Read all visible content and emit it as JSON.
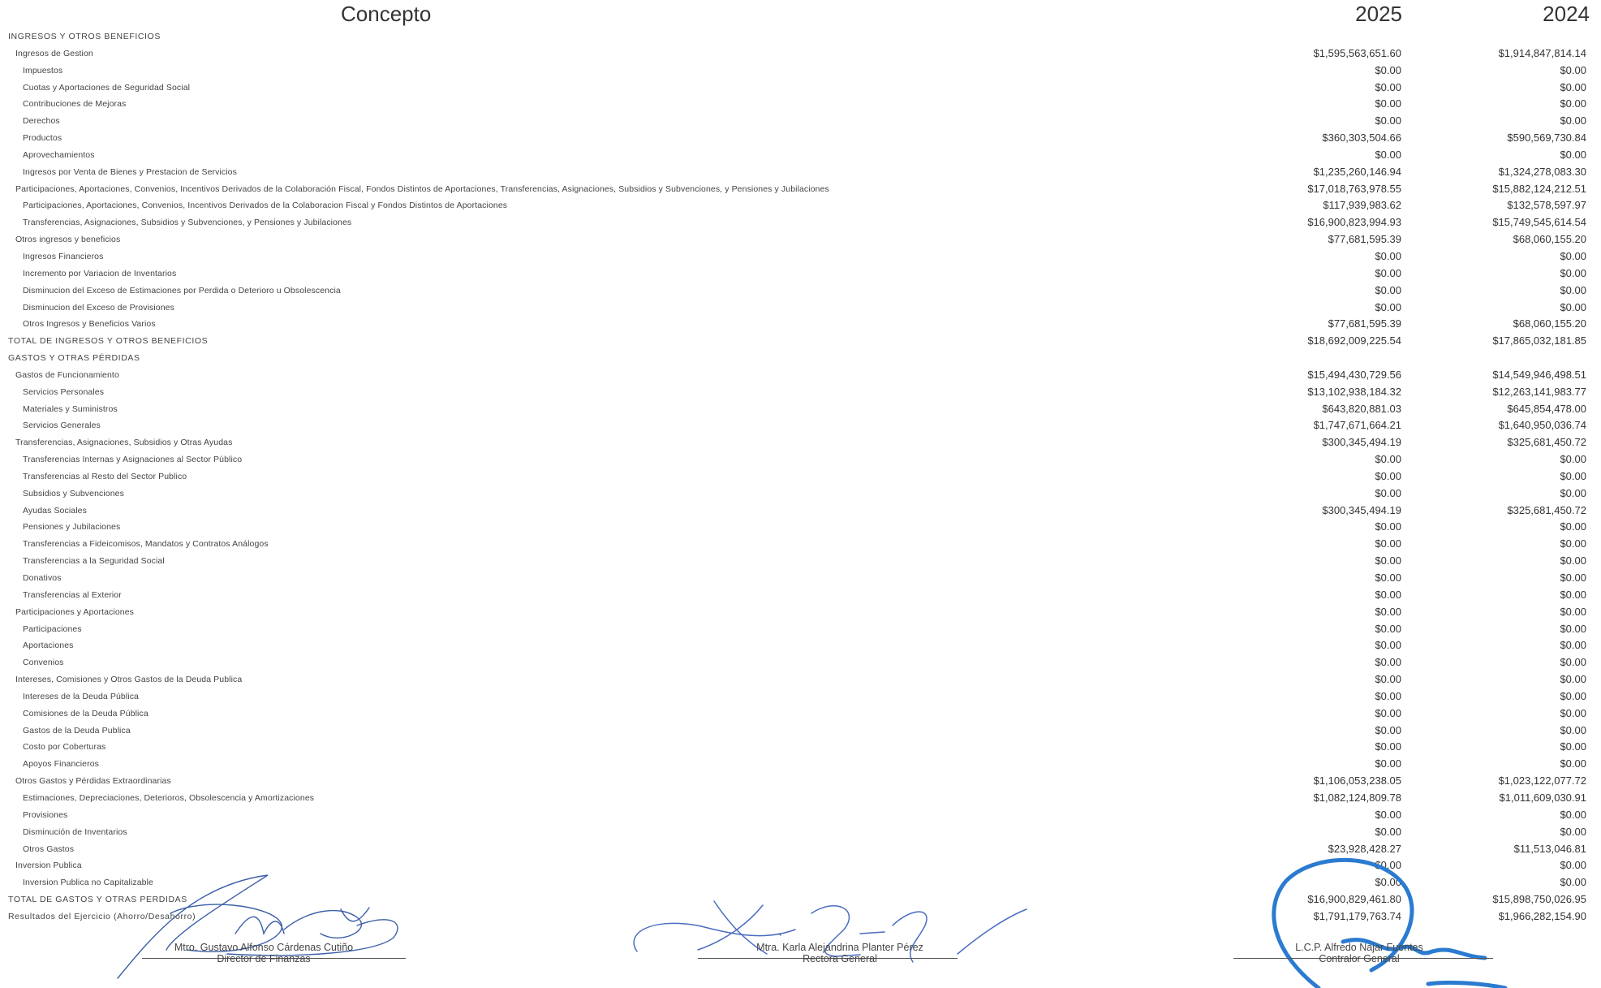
{
  "header": {
    "concept": "Concepto",
    "year_current": "2025",
    "year_previous": "2024"
  },
  "rows": [
    {
      "level": 0,
      "label": "INGRESOS Y OTROS BENEFICIOS",
      "v2025": "",
      "v2024": ""
    },
    {
      "level": 1,
      "label": "Ingresos de Gestion",
      "v2025": "$1,595,563,651.60",
      "v2024": "$1,914,847,814.14"
    },
    {
      "level": 2,
      "label": "Impuestos",
      "v2025": "$0.00",
      "v2024": "$0.00"
    },
    {
      "level": 2,
      "label": "Cuotas y Aportaciones de Seguridad Social",
      "v2025": "$0.00",
      "v2024": "$0.00"
    },
    {
      "level": 2,
      "label": "Contribuciones de Mejoras",
      "v2025": "$0.00",
      "v2024": "$0.00"
    },
    {
      "level": 2,
      "label": "Derechos",
      "v2025": "$0.00",
      "v2024": "$0.00"
    },
    {
      "level": 2,
      "label": "Productos",
      "v2025": "$360,303,504.66",
      "v2024": "$590,569,730.84"
    },
    {
      "level": 2,
      "label": "Aprovechamientos",
      "v2025": "$0.00",
      "v2024": "$0.00"
    },
    {
      "level": 2,
      "label": "Ingresos por Venta de Bienes y Prestacion de Servicios",
      "v2025": "$1,235,260,146.94",
      "v2024": "$1,324,278,083.30"
    },
    {
      "level": 1,
      "label": "Participaciones, Aportaciones, Convenios, Incentivos Derivados de la Colaboración Fiscal, Fondos Distintos de Aportaciones, Transferencias, Asignaciones, Subsidios y Subvenciones, y Pensiones y Jubilaciones",
      "v2025": "$17,018,763,978.55",
      "v2024": "$15,882,124,212.51"
    },
    {
      "level": 2,
      "label": "Participaciones, Aportaciones, Convenios, Incentivos Derivados de la Colaboracion Fiscal y Fondos Distintos de Aportaciones",
      "v2025": "$117,939,983.62",
      "v2024": "$132,578,597.97"
    },
    {
      "level": 2,
      "label": "Transferencias, Asignaciones, Subsidios y Subvenciones, y Pensiones y Jubilaciones",
      "v2025": "$16,900,823,994.93",
      "v2024": "$15,749,545,614.54"
    },
    {
      "level": 1,
      "label": "Otros ingresos y beneficios",
      "v2025": "$77,681,595.39",
      "v2024": "$68,060,155.20"
    },
    {
      "level": 2,
      "label": "Ingresos Financieros",
      "v2025": "$0.00",
      "v2024": "$0.00"
    },
    {
      "level": 2,
      "label": "Incremento por Variacion de Inventarios",
      "v2025": "$0.00",
      "v2024": "$0.00"
    },
    {
      "level": 2,
      "label": "Disminucion del Exceso de Estimaciones por Perdida o Deterioro u Obsolescencia",
      "v2025": "$0.00",
      "v2024": "$0.00"
    },
    {
      "level": 2,
      "label": "Disminucion del Exceso de Provisiones",
      "v2025": "$0.00",
      "v2024": "$0.00"
    },
    {
      "level": 2,
      "label": "Otros Ingresos y Beneficios Varios",
      "v2025": "$77,681,595.39",
      "v2024": "$68,060,155.20"
    },
    {
      "level": 0,
      "label": "TOTAL DE INGRESOS Y OTROS BENEFICIOS",
      "v2025": "$18,692,009,225.54",
      "v2024": "$17,865,032,181.85"
    },
    {
      "level": 0,
      "label": "GASTOS Y OTRAS PÉRDIDAS",
      "v2025": "",
      "v2024": ""
    },
    {
      "level": 1,
      "label": "Gastos de Funcionamiento",
      "v2025": "$15,494,430,729.56",
      "v2024": "$14,549,946,498.51"
    },
    {
      "level": 2,
      "label": "Servicios Personales",
      "v2025": "$13,102,938,184.32",
      "v2024": "$12,263,141,983.77"
    },
    {
      "level": 2,
      "label": "Materiales y Suministros",
      "v2025": "$643,820,881.03",
      "v2024": "$645,854,478.00"
    },
    {
      "level": 2,
      "label": "Servicios Generales",
      "v2025": "$1,747,671,664.21",
      "v2024": "$1,640,950,036.74"
    },
    {
      "level": 1,
      "label": "Transferencias, Asignaciones, Subsidios y Otras Ayudas",
      "v2025": "$300,345,494.19",
      "v2024": "$325,681,450.72"
    },
    {
      "level": 2,
      "label": "Transferencias Internas y Asignaciones al Sector Público",
      "v2025": "$0.00",
      "v2024": "$0.00"
    },
    {
      "level": 2,
      "label": "Transferencias al Resto del Sector Publico",
      "v2025": "$0.00",
      "v2024": "$0.00"
    },
    {
      "level": 2,
      "label": "Subsidios y Subvenciones",
      "v2025": "$0.00",
      "v2024": "$0.00"
    },
    {
      "level": 2,
      "label": "Ayudas Sociales",
      "v2025": "$300,345,494.19",
      "v2024": "$325,681,450.72"
    },
    {
      "level": 2,
      "label": "Pensiones y Jubilaciones",
      "v2025": "$0.00",
      "v2024": "$0.00"
    },
    {
      "level": 2,
      "label": "Transferencias a Fideicomisos, Mandatos y Contratos Análogos",
      "v2025": "$0.00",
      "v2024": "$0.00"
    },
    {
      "level": 2,
      "label": "Transferencias a la Seguridad Social",
      "v2025": "$0.00",
      "v2024": "$0.00"
    },
    {
      "level": 2,
      "label": "Donativos",
      "v2025": "$0.00",
      "v2024": "$0.00"
    },
    {
      "level": 2,
      "label": "Transferencias al Exterior",
      "v2025": "$0.00",
      "v2024": "$0.00"
    },
    {
      "level": 1,
      "label": "Participaciones y Aportaciones",
      "v2025": "$0.00",
      "v2024": "$0.00"
    },
    {
      "level": 2,
      "label": "Participaciones",
      "v2025": "$0.00",
      "v2024": "$0.00"
    },
    {
      "level": 2,
      "label": "Aportaciones",
      "v2025": "$0.00",
      "v2024": "$0.00"
    },
    {
      "level": 2,
      "label": "Convenios",
      "v2025": "$0.00",
      "v2024": "$0.00"
    },
    {
      "level": 1,
      "label": "Intereses, Comisiones y Otros Gastos de la Deuda Publica",
      "v2025": "$0.00",
      "v2024": "$0.00"
    },
    {
      "level": 2,
      "label": "Intereses de la Deuda Pública",
      "v2025": "$0.00",
      "v2024": "$0.00"
    },
    {
      "level": 2,
      "label": "Comisiones de la Deuda Pública",
      "v2025": "$0.00",
      "v2024": "$0.00"
    },
    {
      "level": 2,
      "label": "Gastos de la Deuda Publica",
      "v2025": "$0.00",
      "v2024": "$0.00"
    },
    {
      "level": 2,
      "label": "Costo por Coberturas",
      "v2025": "$0.00",
      "v2024": "$0.00"
    },
    {
      "level": 2,
      "label": "Apoyos Financieros",
      "v2025": "$0.00",
      "v2024": "$0.00"
    },
    {
      "level": 1,
      "label": "Otros Gastos y Pérdidas Extraordinarias",
      "v2025": "$1,106,053,238.05",
      "v2024": "$1,023,122,077.72"
    },
    {
      "level": 2,
      "label": "Estimaciones, Depreciaciones, Deterioros, Obsolescencia y Amortizaciones",
      "v2025": "$1,082,124,809.78",
      "v2024": "$1,011,609,030.91"
    },
    {
      "level": 2,
      "label": "Provisiones",
      "v2025": "$0.00",
      "v2024": "$0.00"
    },
    {
      "level": 2,
      "label": "Disminución de Inventarios",
      "v2025": "$0.00",
      "v2024": "$0.00"
    },
    {
      "level": 2,
      "label": "Otros Gastos",
      "v2025": "$23,928,428.27",
      "v2024": "$11,513,046.81"
    },
    {
      "level": 1,
      "label": "Inversion Publica",
      "v2025": "$0.00",
      "v2024": "$0.00"
    },
    {
      "level": 2,
      "label": "Inversion Publica no Capitalizable",
      "v2025": "$0.00",
      "v2024": "$0.00"
    },
    {
      "level": 0,
      "label": "TOTAL DE GASTOS Y OTRAS PERDIDAS",
      "v2025": "$16,900,829,461.80",
      "v2024": "$15,898,750,026.95"
    },
    {
      "level": 0,
      "label": "Resultados del Ejercicio (Ahorro/Desahorro)",
      "v2025": "$1,791,179,763.74",
      "v2024": "$1,966,282,154.90"
    }
  ],
  "signatures": [
    {
      "name": "Mtro. Gustavo Alfonso Cárdenas Cutiño",
      "title": "Director de Finanzas"
    },
    {
      "name": "Mtra.  Karla Alejandrina Planter Pérez",
      "title": "Rectora General"
    },
    {
      "name": "L.C.P. Alfredo Najar Fuentes",
      "title": "Contralor General"
    }
  ],
  "colors": {
    "ink_blue": "#2b7bd0",
    "ink_dark_blue": "#1f4f9a",
    "text": "#333333"
  }
}
